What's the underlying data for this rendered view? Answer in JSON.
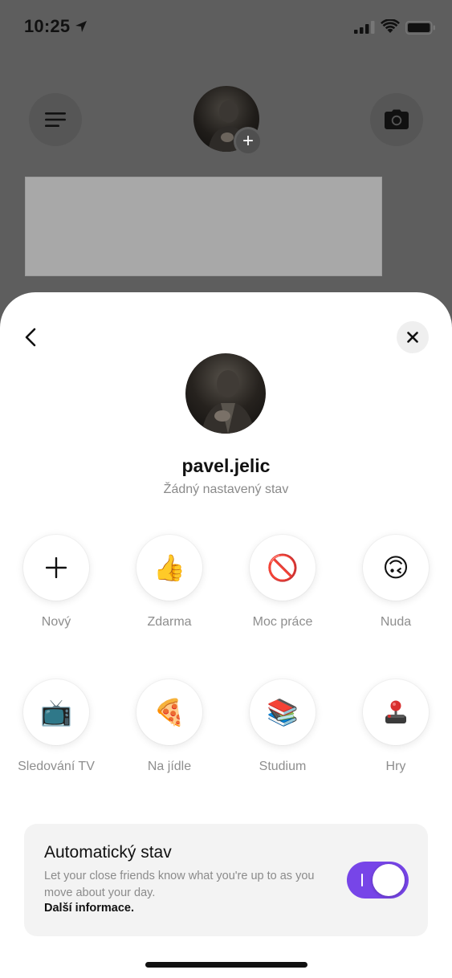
{
  "status_bar": {
    "time": "10:25",
    "icons": [
      "location-arrow-icon",
      "cellular-signal-icon",
      "wifi-icon",
      "battery-icon"
    ]
  },
  "background": {
    "menu_icon": "hamburger-menu-icon",
    "camera_icon": "camera-icon",
    "add_badge": "+"
  },
  "sheet": {
    "back_icon": "chevron-left-icon",
    "close_icon": "close-icon",
    "username": "pavel.jelic",
    "subtitle": "Žádný nastavený stav",
    "statuses": [
      {
        "label": "Nový",
        "icon": "plus-icon",
        "glyph": "+"
      },
      {
        "label": "Zdarma",
        "icon": "thumbs-up-icon",
        "glyph": "👍"
      },
      {
        "label": "Moc práce",
        "icon": "prohibited-icon",
        "glyph": "🚫"
      },
      {
        "label": "Nuda",
        "icon": "upside-down-face-icon",
        "glyph": "🙃"
      },
      {
        "label": "Sledování TV",
        "icon": "television-icon",
        "glyph": "📺"
      },
      {
        "label": "Na jídle",
        "icon": "pizza-icon",
        "glyph": "🍕"
      },
      {
        "label": "Studium",
        "icon": "books-icon",
        "glyph": "📚"
      },
      {
        "label": "Hry",
        "icon": "joystick-icon",
        "glyph": "🕹"
      }
    ],
    "auto_status": {
      "title": "Automatický stav",
      "description": "Let your close friends know what you're up to as you move about your day.",
      "link": "Další informace.",
      "toggle_on": true
    }
  },
  "colors": {
    "accent": "#7745e8",
    "overlay": "#5e5e5e",
    "card_bg": "#f3f3f3"
  }
}
